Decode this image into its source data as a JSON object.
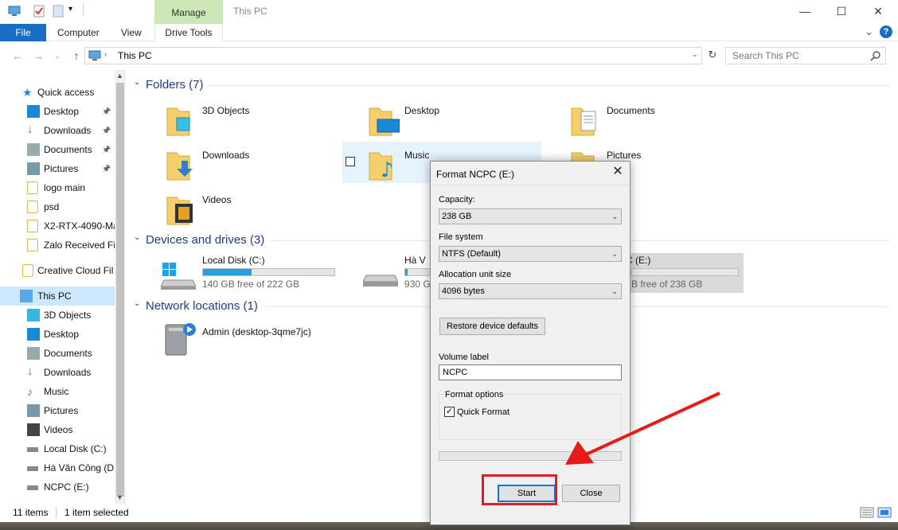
{
  "window": {
    "title": "This PC",
    "manage_tab": "Manage",
    "minimize": "—",
    "maximize": "☐",
    "close": "✕"
  },
  "ribbon": {
    "tabs": [
      "File",
      "Computer",
      "View",
      "Drive Tools"
    ],
    "collapse": "⌄",
    "help": "?"
  },
  "address": {
    "path": "This PC",
    "search_placeholder": "Search This PC"
  },
  "sidebar": {
    "items": [
      {
        "label": "Quick access",
        "icon": "star-icon"
      },
      {
        "label": "Desktop",
        "icon": "desktop-icon",
        "pinned": true
      },
      {
        "label": "Downloads",
        "icon": "download-icon",
        "pinned": true
      },
      {
        "label": "Documents",
        "icon": "documents-icon",
        "pinned": true
      },
      {
        "label": "Pictures",
        "icon": "pictures-icon",
        "pinned": true
      },
      {
        "label": "logo main",
        "icon": "folder-icon"
      },
      {
        "label": "psd",
        "icon": "folder-icon"
      },
      {
        "label": "X2-RTX-4090-Ma",
        "icon": "folder-icon"
      },
      {
        "label": "Zalo Received Fi",
        "icon": "folder-icon"
      },
      {
        "label": "Creative Cloud Fil",
        "icon": "folder-icon"
      },
      {
        "label": "This PC",
        "icon": "computer-icon"
      },
      {
        "label": "3D Objects",
        "icon": "3d-objects-icon"
      },
      {
        "label": "Desktop",
        "icon": "desktop-icon"
      },
      {
        "label": "Documents",
        "icon": "documents-icon"
      },
      {
        "label": "Downloads",
        "icon": "download-icon"
      },
      {
        "label": "Music",
        "icon": "music-icon"
      },
      {
        "label": "Pictures",
        "icon": "pictures-icon"
      },
      {
        "label": "Videos",
        "icon": "videos-icon"
      },
      {
        "label": "Local Disk (C:)",
        "icon": "drive-icon"
      },
      {
        "label": "Hà Văn Công (D:",
        "icon": "drive-icon"
      },
      {
        "label": "NCPC (E:)",
        "icon": "drive-icon"
      }
    ]
  },
  "content": {
    "folders_header": "Folders (7)",
    "folders": [
      "3D Objects",
      "Desktop",
      "Documents",
      "Downloads",
      "Music",
      "Pictures",
      "Videos"
    ],
    "devices_header": "Devices and drives (3)",
    "drives": [
      {
        "name": "Local Disk (C:)",
        "free": "140 GB free of 222 GB",
        "used_fraction": 0.37
      },
      {
        "name": "Hà V",
        "free": "930 G",
        "used_fraction": 0.1
      },
      {
        "name": "C (E:)",
        "free": "B free of 238 GB",
        "used_fraction": 0.0
      }
    ],
    "network_header": "Network locations (1)",
    "network": [
      "Admin (desktop-3qme7jc)"
    ]
  },
  "status": {
    "items_count": "11 items",
    "selected": "1 item selected"
  },
  "dialog": {
    "title": "Format NCPC (E:)",
    "capacity_label": "Capacity:",
    "capacity_value": "238 GB",
    "fs_label": "File system",
    "fs_value": "NTFS (Default)",
    "alloc_label": "Allocation unit size",
    "alloc_value": "4096 bytes",
    "restore_btn": "Restore device defaults",
    "volume_label": "Volume label",
    "volume_value": "NCPC",
    "format_options": "Format options",
    "quick_format": "Quick Format",
    "quick_format_checked": true,
    "start_btn": "Start",
    "close_btn": "Close"
  },
  "colors": {
    "accent": "#1a6dc5",
    "manage_bg": "#cde8b6",
    "annotation": "#e81a1a",
    "selection": "#cce8ff"
  }
}
